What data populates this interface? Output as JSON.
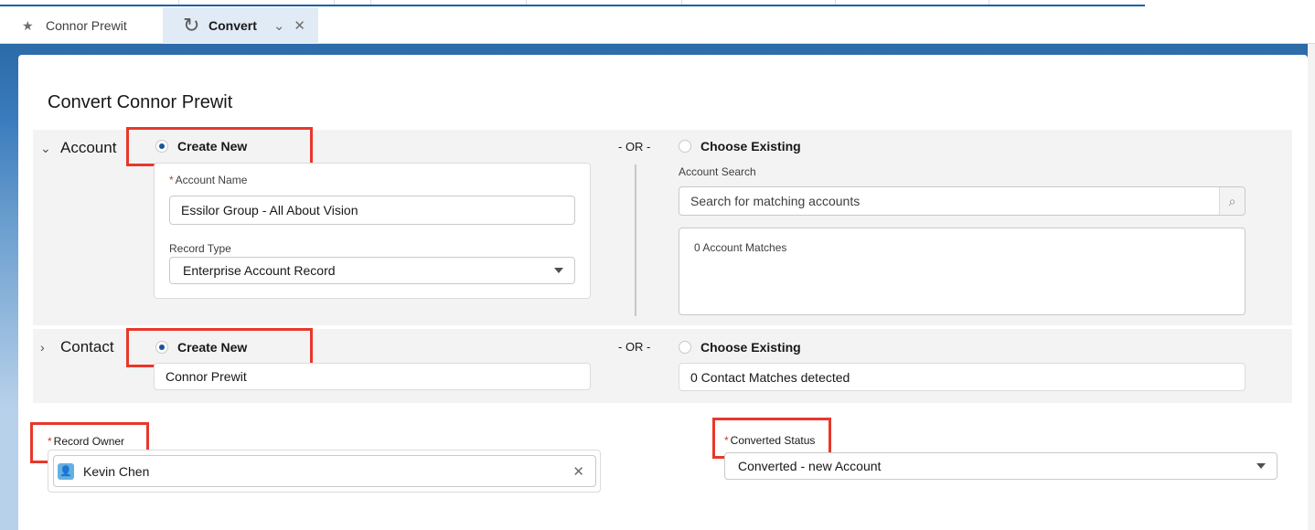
{
  "tabs": [
    {
      "label": "Connor Prewit",
      "icon": "lead-icon"
    },
    {
      "label": "Convert",
      "icon": "convert-arrow-icon"
    }
  ],
  "modal": {
    "title": "Convert Connor Prewit"
  },
  "account": {
    "heading": "Account",
    "create_new_label": "Create New",
    "or_label": "- OR -",
    "choose_existing_label": "Choose Existing",
    "account_name_label": "Account Name",
    "account_name_value": "Essilor Group - All About Vision",
    "record_type_label": "Record Type",
    "record_type_value": "Enterprise Account Record",
    "search_label": "Account Search",
    "search_placeholder": "Search for matching accounts",
    "matches_text": "0 Account Matches"
  },
  "contact": {
    "heading": "Contact",
    "create_new_label": "Create New",
    "or_label": "- OR -",
    "choose_existing_label": "Choose Existing",
    "name_value": "Connor Prewit",
    "matches_text": "0 Contact Matches detected"
  },
  "record_owner": {
    "label": "Record Owner",
    "value": "Kevin Chen"
  },
  "converted_status": {
    "label": "Converted Status",
    "value": "Converted - new Account"
  },
  "colors": {
    "highlight_box": "#e8372a",
    "radio_selected": "#1b5297",
    "brand_blue": "#2c6aa8"
  }
}
